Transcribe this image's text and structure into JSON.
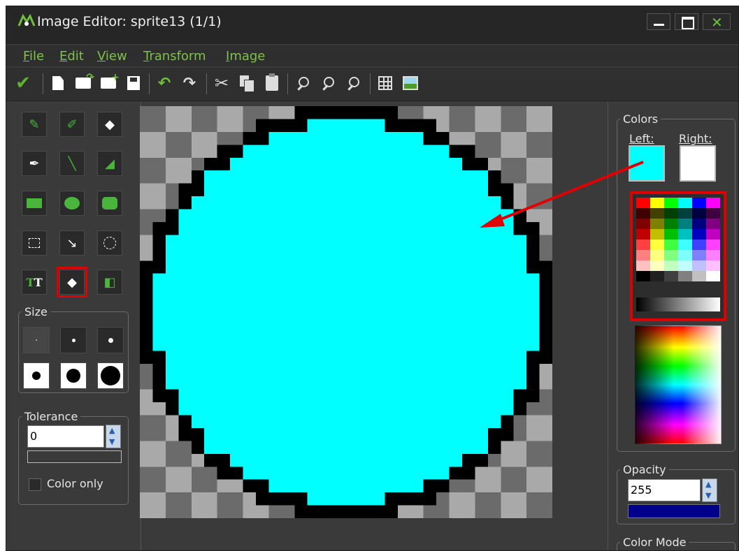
{
  "window": {
    "title": "Image Editor: sprite13 (1/1)"
  },
  "menu": [
    {
      "accel": "F",
      "rest": "ile"
    },
    {
      "accel": "E",
      "rest": "dit"
    },
    {
      "accel": "V",
      "rest": "iew"
    },
    {
      "accel": "T",
      "rest": "ransform"
    },
    {
      "accel": "I",
      "rest": "mage"
    }
  ],
  "toolbar_icons": [
    "checkmark-icon",
    "new-image-icon",
    "open-icon",
    "import-icon",
    "save-icon",
    "undo-icon",
    "redo-icon",
    "cut-icon",
    "copy-icon",
    "paste-icon",
    "zoom-in-icon",
    "zoom-out-icon",
    "zoom-reset-icon",
    "grid-icon",
    "image-icon"
  ],
  "tools": [
    "pencil",
    "spray",
    "eraser",
    "color-picker",
    "line",
    "polygon",
    "rectangle",
    "ellipse",
    "rounded-rectangle",
    "select-rectangle",
    "magic-wand",
    "select-ellipse",
    "text",
    "fill",
    "paste-sprite"
  ],
  "selected_tool": "fill",
  "size_panel": {
    "title": "Size",
    "options": [
      1,
      2,
      3,
      4,
      5,
      6
    ],
    "selected": 1
  },
  "tolerance_panel": {
    "title": "Tolerance",
    "value": "0",
    "color_only_label": "Color only",
    "color_only_checked": false
  },
  "colors_panel": {
    "title": "Colors",
    "left_label": "Left:",
    "right_label": "Right:",
    "left_color": "#00ffff",
    "right_color": "#ffffff"
  },
  "palette": [
    "#ff0000",
    "#ffff00",
    "#00ff00",
    "#00ffff",
    "#0000ff",
    "#ff00ff",
    "#400000",
    "#404000",
    "#004000",
    "#004040",
    "#000040",
    "#400040",
    "#800000",
    "#808000",
    "#008000",
    "#008080",
    "#000080",
    "#800080",
    "#c00000",
    "#c0c000",
    "#00c000",
    "#00c0c0",
    "#0000c0",
    "#c000c0",
    "#ff4040",
    "#ffff40",
    "#40ff40",
    "#40ffff",
    "#4040ff",
    "#ff40ff",
    "#ff8080",
    "#ffff80",
    "#80ff80",
    "#80ffff",
    "#8080ff",
    "#ff80ff",
    "#ffc0c0",
    "#ffffc0",
    "#c0ffc0",
    "#c0ffff",
    "#c0c0ff",
    "#ffc0ff",
    "#000000",
    "#202020",
    "#404040",
    "#808080",
    "#c0c0c0",
    "#ffffff"
  ],
  "opacity_panel": {
    "title": "Opacity",
    "value": "255",
    "bar_color": "#00008b"
  },
  "color_mode_panel": {
    "title": "Color Mode"
  },
  "sprite": {
    "grid_size": 32,
    "fill_color": "#00ffff",
    "outline_color": "#000000",
    "transparent_light": "#a9a9a9",
    "transparent_dark": "#6b6b6b"
  },
  "annotation": {
    "color": "#e10000"
  }
}
